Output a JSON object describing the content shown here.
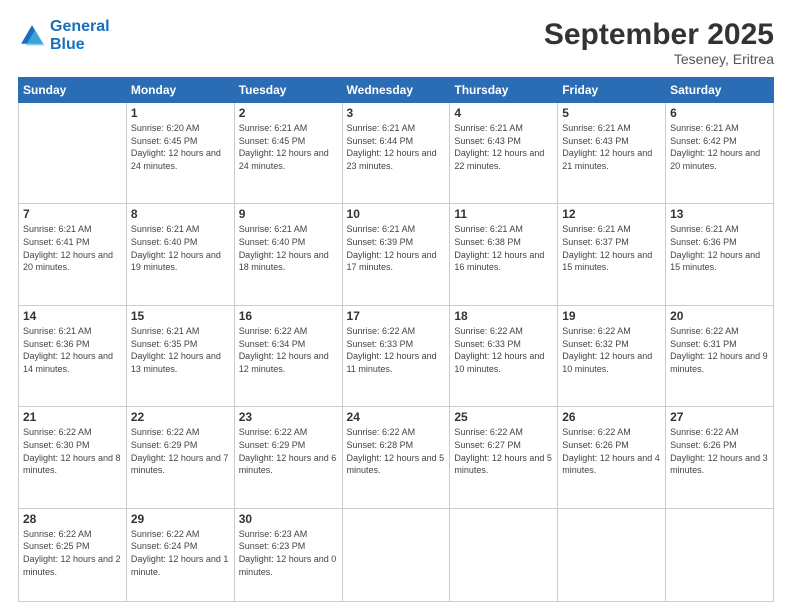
{
  "header": {
    "logo_line1": "General",
    "logo_line2": "Blue",
    "month": "September 2025",
    "location": "Teseney, Eritrea"
  },
  "days_of_week": [
    "Sunday",
    "Monday",
    "Tuesday",
    "Wednesday",
    "Thursday",
    "Friday",
    "Saturday"
  ],
  "weeks": [
    [
      {
        "day": "",
        "info": ""
      },
      {
        "day": "1",
        "info": "Sunrise: 6:20 AM\nSunset: 6:45 PM\nDaylight: 12 hours and 24 minutes."
      },
      {
        "day": "2",
        "info": "Sunrise: 6:21 AM\nSunset: 6:45 PM\nDaylight: 12 hours and 24 minutes."
      },
      {
        "day": "3",
        "info": "Sunrise: 6:21 AM\nSunset: 6:44 PM\nDaylight: 12 hours and 23 minutes."
      },
      {
        "day": "4",
        "info": "Sunrise: 6:21 AM\nSunset: 6:43 PM\nDaylight: 12 hours and 22 minutes."
      },
      {
        "day": "5",
        "info": "Sunrise: 6:21 AM\nSunset: 6:43 PM\nDaylight: 12 hours and 21 minutes."
      },
      {
        "day": "6",
        "info": "Sunrise: 6:21 AM\nSunset: 6:42 PM\nDaylight: 12 hours and 20 minutes."
      }
    ],
    [
      {
        "day": "7",
        "info": "Sunrise: 6:21 AM\nSunset: 6:41 PM\nDaylight: 12 hours and 20 minutes."
      },
      {
        "day": "8",
        "info": "Sunrise: 6:21 AM\nSunset: 6:40 PM\nDaylight: 12 hours and 19 minutes."
      },
      {
        "day": "9",
        "info": "Sunrise: 6:21 AM\nSunset: 6:40 PM\nDaylight: 12 hours and 18 minutes."
      },
      {
        "day": "10",
        "info": "Sunrise: 6:21 AM\nSunset: 6:39 PM\nDaylight: 12 hours and 17 minutes."
      },
      {
        "day": "11",
        "info": "Sunrise: 6:21 AM\nSunset: 6:38 PM\nDaylight: 12 hours and 16 minutes."
      },
      {
        "day": "12",
        "info": "Sunrise: 6:21 AM\nSunset: 6:37 PM\nDaylight: 12 hours and 15 minutes."
      },
      {
        "day": "13",
        "info": "Sunrise: 6:21 AM\nSunset: 6:36 PM\nDaylight: 12 hours and 15 minutes."
      }
    ],
    [
      {
        "day": "14",
        "info": "Sunrise: 6:21 AM\nSunset: 6:36 PM\nDaylight: 12 hours and 14 minutes."
      },
      {
        "day": "15",
        "info": "Sunrise: 6:21 AM\nSunset: 6:35 PM\nDaylight: 12 hours and 13 minutes."
      },
      {
        "day": "16",
        "info": "Sunrise: 6:22 AM\nSunset: 6:34 PM\nDaylight: 12 hours and 12 minutes."
      },
      {
        "day": "17",
        "info": "Sunrise: 6:22 AM\nSunset: 6:33 PM\nDaylight: 12 hours and 11 minutes."
      },
      {
        "day": "18",
        "info": "Sunrise: 6:22 AM\nSunset: 6:33 PM\nDaylight: 12 hours and 10 minutes."
      },
      {
        "day": "19",
        "info": "Sunrise: 6:22 AM\nSunset: 6:32 PM\nDaylight: 12 hours and 10 minutes."
      },
      {
        "day": "20",
        "info": "Sunrise: 6:22 AM\nSunset: 6:31 PM\nDaylight: 12 hours and 9 minutes."
      }
    ],
    [
      {
        "day": "21",
        "info": "Sunrise: 6:22 AM\nSunset: 6:30 PM\nDaylight: 12 hours and 8 minutes."
      },
      {
        "day": "22",
        "info": "Sunrise: 6:22 AM\nSunset: 6:29 PM\nDaylight: 12 hours and 7 minutes."
      },
      {
        "day": "23",
        "info": "Sunrise: 6:22 AM\nSunset: 6:29 PM\nDaylight: 12 hours and 6 minutes."
      },
      {
        "day": "24",
        "info": "Sunrise: 6:22 AM\nSunset: 6:28 PM\nDaylight: 12 hours and 5 minutes."
      },
      {
        "day": "25",
        "info": "Sunrise: 6:22 AM\nSunset: 6:27 PM\nDaylight: 12 hours and 5 minutes."
      },
      {
        "day": "26",
        "info": "Sunrise: 6:22 AM\nSunset: 6:26 PM\nDaylight: 12 hours and 4 minutes."
      },
      {
        "day": "27",
        "info": "Sunrise: 6:22 AM\nSunset: 6:26 PM\nDaylight: 12 hours and 3 minutes."
      }
    ],
    [
      {
        "day": "28",
        "info": "Sunrise: 6:22 AM\nSunset: 6:25 PM\nDaylight: 12 hours and 2 minutes."
      },
      {
        "day": "29",
        "info": "Sunrise: 6:22 AM\nSunset: 6:24 PM\nDaylight: 12 hours and 1 minute."
      },
      {
        "day": "30",
        "info": "Sunrise: 6:23 AM\nSunset: 6:23 PM\nDaylight: 12 hours and 0 minutes."
      },
      {
        "day": "",
        "info": ""
      },
      {
        "day": "",
        "info": ""
      },
      {
        "day": "",
        "info": ""
      },
      {
        "day": "",
        "info": ""
      }
    ]
  ]
}
